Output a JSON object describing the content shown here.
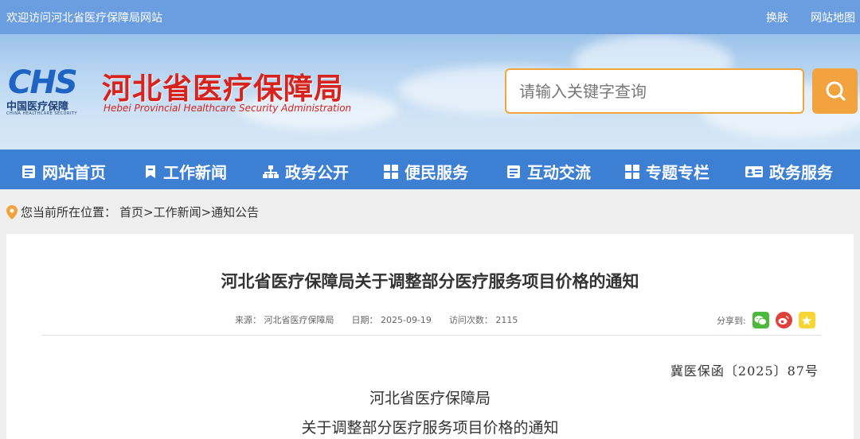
{
  "topbar": {
    "welcome": "欢迎访问河北省医疗保障局网站",
    "links": [
      "换肤",
      "网站地图"
    ]
  },
  "header": {
    "logo_abbr": "CHS",
    "logo_cn": "中国医疗保障",
    "logo_en": "CHINA HEALTHCARE SECURITY",
    "site_title": "河北省医疗保障局",
    "site_title_en": "Hebei Provincial Healthcare Security Administration",
    "search_placeholder": "请输入关键字查询"
  },
  "nav": {
    "items": [
      {
        "label": "网站首页",
        "icon": "document-icon"
      },
      {
        "label": "工作新闻",
        "icon": "bookmark-icon"
      },
      {
        "label": "政务公开",
        "icon": "sitemap-icon"
      },
      {
        "label": "便民服务",
        "icon": "grid-icon"
      },
      {
        "label": "互动交流",
        "icon": "document-icon"
      },
      {
        "label": "专题专栏",
        "icon": "grid-icon"
      },
      {
        "label": "政务服务",
        "icon": "id-card-icon"
      }
    ]
  },
  "breadcrumb": {
    "prefix": "您当前所在位置：",
    "path": "首页>工作新闻>通知公告"
  },
  "article": {
    "title": "河北省医疗保障局关于调整部分医疗服务项目价格的通知",
    "source": "来源： 河北省医疗保障局",
    "date": "日期： 2025-09-19",
    "views": "访问次数： 2115",
    "share_label": "分享到:",
    "doc_number": "冀医保函〔2025〕87号",
    "doc_org": "河北省医疗保障局",
    "doc_subject": "关于调整部分医疗服务项目价格的通知"
  },
  "colors": {
    "topbar": "#6b9ee0",
    "nav": "#3d7fd3",
    "accent": "#f2a33e",
    "title_red": "#d6231d"
  }
}
